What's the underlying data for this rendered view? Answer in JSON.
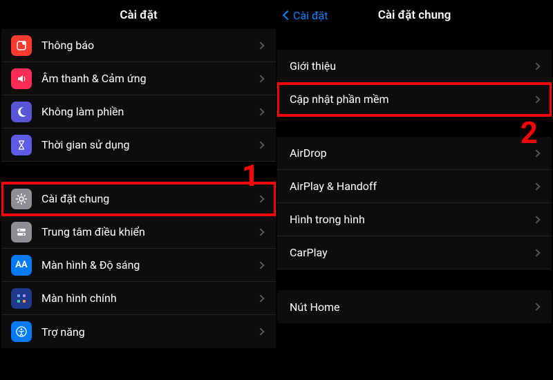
{
  "left": {
    "title": "Cài đặt",
    "items": [
      {
        "key": "notifications",
        "label": "Thông báo",
        "iconClass": "ic-red",
        "iconName": "notification-icon"
      },
      {
        "key": "sounds",
        "label": "Âm thanh & Cảm ứng",
        "iconClass": "ic-pink",
        "iconName": "sound-icon"
      },
      {
        "key": "dnd",
        "label": "Không làm phiền",
        "iconClass": "ic-purple",
        "iconName": "moon-icon"
      },
      {
        "key": "screentime",
        "label": "Thời gian sử dụng",
        "iconClass": "ic-violet",
        "iconName": "hourglass-icon"
      }
    ],
    "items2": [
      {
        "key": "general",
        "label": "Cài đặt chung",
        "iconClass": "ic-gray",
        "iconName": "gear-icon",
        "highlight": true
      },
      {
        "key": "controlcenter",
        "label": "Trung tâm điều khiển",
        "iconClass": "ic-gray2",
        "iconName": "toggles-icon"
      },
      {
        "key": "display",
        "label": "Màn hình & Độ sáng",
        "iconClass": "ic-blue",
        "iconName": "text-size-icon"
      },
      {
        "key": "homescreen",
        "label": "Màn hình chính",
        "iconClass": "ic-darkblue",
        "iconName": "grid-icon"
      },
      {
        "key": "accessibility",
        "label": "Trợ năng",
        "iconClass": "ic-iblue",
        "iconName": "accessibility-icon"
      }
    ],
    "step_label": "1"
  },
  "right": {
    "back_label": "Cài đặt",
    "title": "Cài đặt chung",
    "group1": [
      {
        "key": "about",
        "label": "Giới thiệu"
      },
      {
        "key": "software-update",
        "label": "Cập nhật phần mềm",
        "highlight": true
      }
    ],
    "group2": [
      {
        "key": "airdrop",
        "label": "AirDrop"
      },
      {
        "key": "airplay",
        "label": "AirPlay & Handoff"
      },
      {
        "key": "pip",
        "label": "Hình trong hình"
      },
      {
        "key": "carplay",
        "label": "CarPlay"
      }
    ],
    "group3": [
      {
        "key": "homebutton",
        "label": "Nút Home"
      }
    ],
    "step_label": "2"
  }
}
